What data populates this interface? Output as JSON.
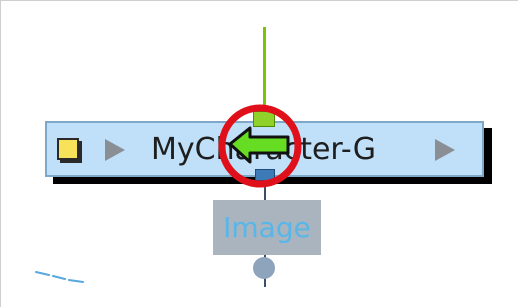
{
  "node": {
    "label": "MyCharacter-G",
    "checkbox_color": "#f8e25a",
    "body_color": "#bfe0f8"
  },
  "image_tag": {
    "label": "Image"
  },
  "icons": {
    "checkbox": "checkbox-icon",
    "expand_left": "play-arrow-icon",
    "expand_right": "play-arrow-icon",
    "cursor": "green-arrow-cursor-icon",
    "highlight": "red-circle-highlight-icon"
  },
  "colors": {
    "connector_top": "#7dc400",
    "connector_bottom": "#3b4f66",
    "highlight_ring": "#e0101a",
    "cursor_fill": "#66dd22"
  }
}
